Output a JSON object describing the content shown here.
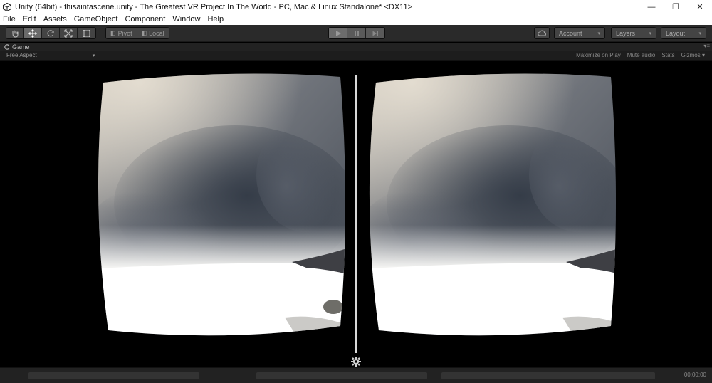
{
  "window": {
    "title": "Unity (64bit) - thisaintascene.unity - The Greatest VR Project In The World - PC, Mac & Linux Standalone* <DX11>",
    "minimize": "—",
    "restore": "❐",
    "close": "✕"
  },
  "menu": {
    "items": [
      "File",
      "Edit",
      "Assets",
      "GameObject",
      "Component",
      "Window",
      "Help"
    ]
  },
  "toolbar": {
    "tools": [
      "hand-icon",
      "move-icon",
      "rotate-icon",
      "scale-icon",
      "rect-tool-icon"
    ],
    "active_tool": "move-icon",
    "pivot_label": "Pivot",
    "local_label": "Local",
    "play_controls": [
      "play-icon",
      "pause-icon",
      "step-icon"
    ],
    "account_label": "Account",
    "layers_label": "Layers",
    "layout_label": "Layout"
  },
  "panel": {
    "tab_label": "Game",
    "aspect_label": "Free Aspect",
    "options": [
      "Maximize on Play",
      "Mute audio",
      "Stats",
      "Gizmos"
    ]
  },
  "status": {
    "text": "00:00:00"
  },
  "colors": {
    "toolbar_bg": "#2a2a2a",
    "viewport_bg": "#000000",
    "divider": "#d8d8d8",
    "sky_top": "#c9c2b6",
    "cloud_dark": "#3c434f",
    "ground": "#ffffff"
  }
}
